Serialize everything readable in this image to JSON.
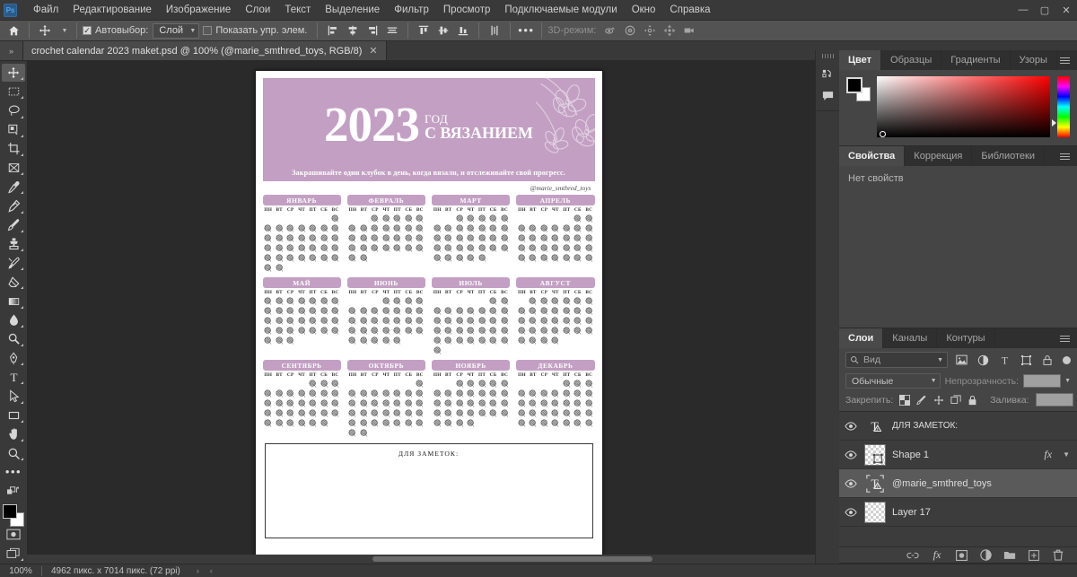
{
  "app": {
    "name": "Adobe Photoshop",
    "logo_text": "Ps"
  },
  "menubar": {
    "items": [
      "Файл",
      "Редактирование",
      "Изображение",
      "Слои",
      "Текст",
      "Выделение",
      "Фильтр",
      "Просмотр",
      "Подключаемые модули",
      "Окно",
      "Справка"
    ],
    "window_controls": {
      "minimize": "—",
      "maximize": "▢",
      "close": "✕"
    }
  },
  "options_bar": {
    "home_icon": "home-icon",
    "tool_icon": "move-tool-icon",
    "autoselect_label": "Автовыбор:",
    "autoselect_checked": true,
    "autoselect_value": "Слой",
    "show_controls_label": "Показать упр. элем.",
    "show_controls_checked": false,
    "align_icons": [
      "align-left-edges",
      "align-horizontal-centers",
      "align-right-edges",
      "distribute-horizontally"
    ],
    "distribute_icons": [
      "align-top-edges",
      "align-vertical-centers",
      "align-bottom-edges",
      "distribute-vertically"
    ],
    "more_label": "•••",
    "mode3d_label": "3D-режим:",
    "mode3d_icons": [
      "orbit-3d-icon",
      "roll-3d-icon",
      "pan-3d-icon",
      "slide-3d-icon",
      "camera-3d-icon"
    ]
  },
  "tab_bar": {
    "overflow_arrow": "»",
    "document_title": "crochet calendar 2023 maket.psd @ 100% (@marie_smthred_toys, RGB/8)",
    "close_glyph": "✕"
  },
  "toolbar": {
    "tools": [
      {
        "name": "move-tool",
        "active": true
      },
      {
        "name": "rectangular-marquee-tool",
        "active": false
      },
      {
        "name": "lasso-tool",
        "active": false
      },
      {
        "name": "object-selection-tool",
        "active": false
      },
      {
        "name": "crop-tool",
        "active": false
      },
      {
        "name": "frame-tool",
        "active": false
      },
      {
        "name": "eyedropper-tool",
        "active": false
      },
      {
        "name": "spot-healing-brush-tool",
        "active": false
      },
      {
        "name": "brush-tool",
        "active": false
      },
      {
        "name": "clone-stamp-tool",
        "active": false
      },
      {
        "name": "history-brush-tool",
        "active": false
      },
      {
        "name": "eraser-tool",
        "active": false
      },
      {
        "name": "gradient-tool",
        "active": false
      },
      {
        "name": "blur-tool",
        "active": false
      },
      {
        "name": "dodge-tool",
        "active": false
      },
      {
        "name": "pen-tool",
        "active": false
      },
      {
        "name": "type-tool",
        "active": false
      },
      {
        "name": "path-selection-tool",
        "active": false
      },
      {
        "name": "rectangle-tool",
        "active": false
      },
      {
        "name": "hand-tool",
        "active": false
      },
      {
        "name": "zoom-tool",
        "active": false
      },
      {
        "name": "edit-toolbar-tool",
        "active": false
      }
    ],
    "foreground_color": "#000000",
    "background_color": "#ffffff",
    "quickmask_name": "quick-mask-mode",
    "screenmode_name": "screen-mode"
  },
  "dock_rail": {
    "buttons": [
      "history-panel-icon",
      "comments-panel-icon"
    ]
  },
  "panels": {
    "color": {
      "tabs": [
        "Цвет",
        "Образцы",
        "Градиенты",
        "Узоры"
      ],
      "active_tab": "Цвет",
      "foreground": "#000000",
      "background": "#ffffff"
    },
    "properties": {
      "tabs": [
        "Свойства",
        "Коррекция",
        "Библиотеки"
      ],
      "active_tab": "Свойства",
      "empty_message": "Нет свойств"
    },
    "layers": {
      "tabs": [
        "Слои",
        "Каналы",
        "Контуры"
      ],
      "active_tab": "Слои",
      "filter_placeholder": "Вид",
      "filter_icons": [
        "filter-image-icon",
        "filter-adjustment-icon",
        "filter-type-icon",
        "filter-shape-icon",
        "filter-smartobject-icon"
      ],
      "blend_mode": "Обычные",
      "opacity_label": "Непрозрачность:",
      "opacity_value": "",
      "lock_label": "Закрепить:",
      "lock_icons": [
        "lock-transparent-pixels",
        "lock-image-pixels",
        "lock-position",
        "lock-artboard-nesting",
        "lock-all"
      ],
      "fill_label": "Заливка:",
      "fill_value": "",
      "items": [
        {
          "name": "ДЛЯ ЗАМЕТОК:",
          "type": "text",
          "visible": true,
          "selected": false,
          "has_fx": false
        },
        {
          "name": "Shape 1",
          "type": "shape",
          "visible": true,
          "selected": false,
          "has_fx": true,
          "fx_label": "fx"
        },
        {
          "name": "@marie_smthred_toys",
          "type": "text",
          "visible": true,
          "selected": true,
          "has_fx": false
        },
        {
          "name": "Layer 17",
          "type": "raster",
          "visible": true,
          "selected": false,
          "has_fx": false
        }
      ],
      "bottom_icons": [
        "link-layers-icon",
        "layer-style-icon",
        "layer-mask-icon",
        "adjustment-layer-icon",
        "new-group-icon",
        "new-layer-icon",
        "delete-layer-icon"
      ],
      "bottom_fx_label": "fx"
    }
  },
  "document": {
    "header": {
      "year": "2023",
      "sub_line1": "ГОД",
      "sub_line2": "С ВЯЗАНИЕМ",
      "tagline": "Закрашивайте один клубок в день, когда вязали, и отслеживайте свой прогресс.",
      "handle": "@marie_smthred_toys",
      "banner_color": "#c3a0c3"
    },
    "weekdays": [
      "ПН",
      "ВТ",
      "СР",
      "ЧТ",
      "ПТ",
      "СБ",
      "ВС"
    ],
    "months": [
      {
        "name": "ЯНВАРЬ",
        "offset": 6,
        "days": 31
      },
      {
        "name": "ФЕВРАЛЬ",
        "offset": 2,
        "days": 28
      },
      {
        "name": "МАРТ",
        "offset": 2,
        "days": 31
      },
      {
        "name": "АПРЕЛЬ",
        "offset": 5,
        "days": 30
      },
      {
        "name": "МАЙ",
        "offset": 0,
        "days": 31
      },
      {
        "name": "ИЮНЬ",
        "offset": 3,
        "days": 30
      },
      {
        "name": "ИЮЛЬ",
        "offset": 5,
        "days": 31
      },
      {
        "name": "АВГУСТ",
        "offset": 1,
        "days": 31
      },
      {
        "name": "СЕНТЯБРЬ",
        "offset": 4,
        "days": 30
      },
      {
        "name": "ОКТЯБРЬ",
        "offset": 6,
        "days": 31
      },
      {
        "name": "НОЯБРЬ",
        "offset": 2,
        "days": 30
      },
      {
        "name": "ДЕКАБРЬ",
        "offset": 4,
        "days": 31
      }
    ],
    "notes": {
      "title": "ДЛЯ ЗАМЕТОК:"
    }
  },
  "status_bar": {
    "zoom": "100%",
    "dimensions": "4962 пикс. x 7014 пикс. (72 ppi)",
    "expand_arrow": "›",
    "left_arrow": "‹"
  }
}
